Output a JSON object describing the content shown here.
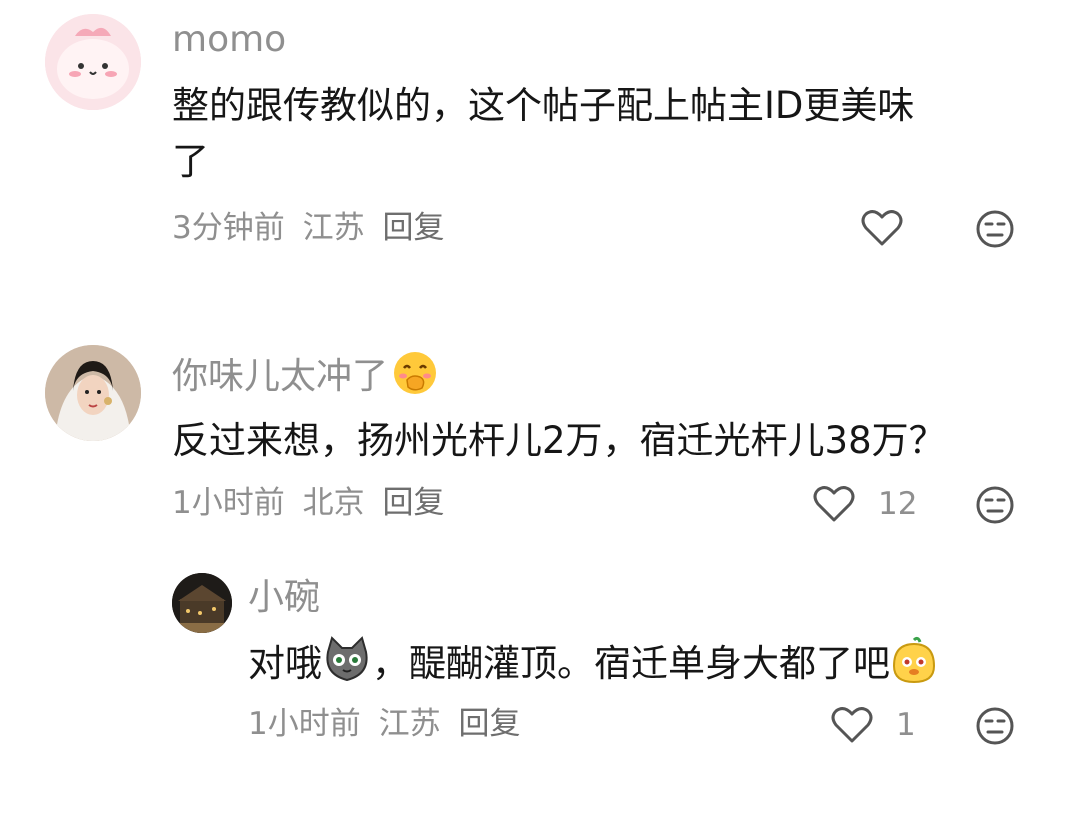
{
  "comments": [
    {
      "username": "momo",
      "text_line1": "整的跟传教似的，这个帖子配上帖主ID更美味",
      "text_line2": "了",
      "time": "3分钟前",
      "location": "江苏",
      "reply_label": "回复",
      "like_count": ""
    },
    {
      "username": "你味儿太冲了",
      "username_emoji": "covering-mouth-emoji",
      "text": "反过来想，扬州光杆儿2万，宿迁光杆儿38万？",
      "time": "1小时前",
      "location": "北京",
      "reply_label": "回复",
      "like_count": "12"
    }
  ],
  "reply": {
    "username": "小碗",
    "text_part1": "对哦",
    "emoji1": "cat-face-sticker",
    "text_part2": "，醍醐灌顶。宿迁单身大都了吧",
    "emoji2": "cute-mascot-sticker",
    "time": "1小时前",
    "location": "江苏",
    "reply_label": "回复",
    "like_count": "1"
  },
  "icons": {
    "like": "heart-outline-icon",
    "dislike": "neutral-face-icon"
  },
  "colors": {
    "meta_text": "#8f8f8f",
    "content_text": "#161616",
    "icon_stroke": "#555555"
  }
}
